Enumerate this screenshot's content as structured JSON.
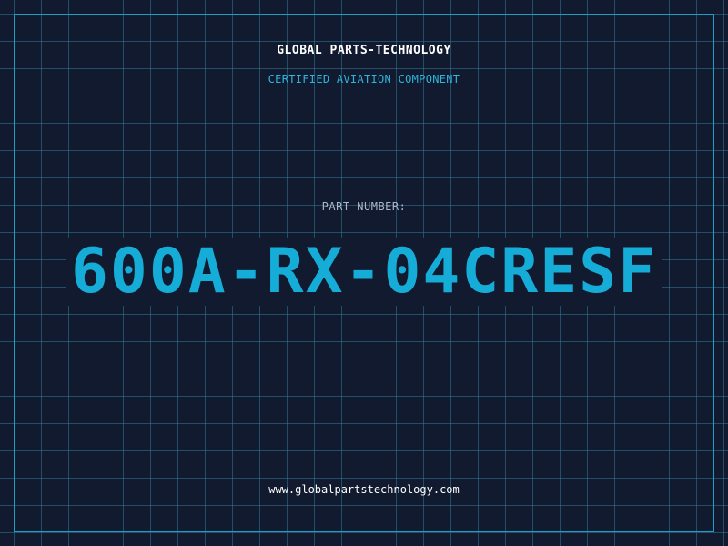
{
  "header": {
    "brand": "GLOBAL PARTS-TECHNOLOGY",
    "tagline": "CERTIFIED AVIATION COMPONENT"
  },
  "part": {
    "label": "PART NUMBER:",
    "number": "600A-RX-04CRESF"
  },
  "footer": {
    "url": "www.globalpartstechnology.com"
  },
  "colors": {
    "background": "#111a2e",
    "grid": "#307896",
    "frame": "#1a9fc7",
    "accent": "#16acd8",
    "label": "#aab6c6",
    "text": "#ffffff"
  }
}
